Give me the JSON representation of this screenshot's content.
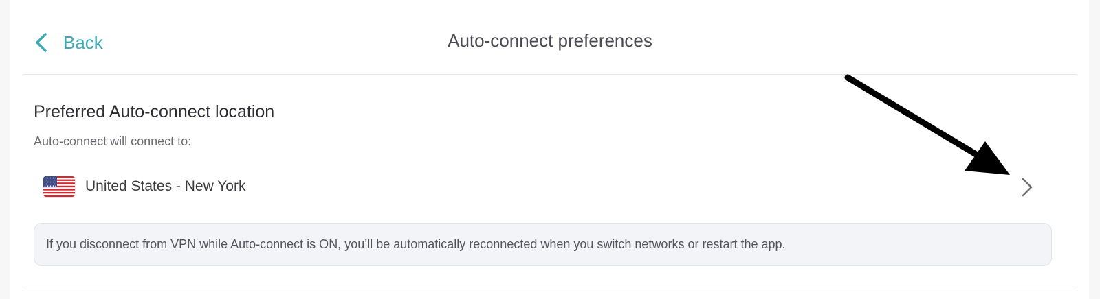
{
  "header": {
    "back_label": "Back",
    "title": "Auto-connect preferences"
  },
  "section": {
    "title": "Preferred Auto-connect location",
    "subtitle": "Auto-connect will connect to:"
  },
  "location": {
    "country_flag": "us-flag-icon",
    "label": "United States - New York"
  },
  "info": {
    "text": "If you disconnect from VPN while Auto-connect is ON, you’ll be automatically reconnected when you switch networks or restart the app."
  },
  "colors": {
    "accent": "#3aaab7",
    "info_background": "#f3f4f7",
    "annotation_arrow": "#000000"
  }
}
